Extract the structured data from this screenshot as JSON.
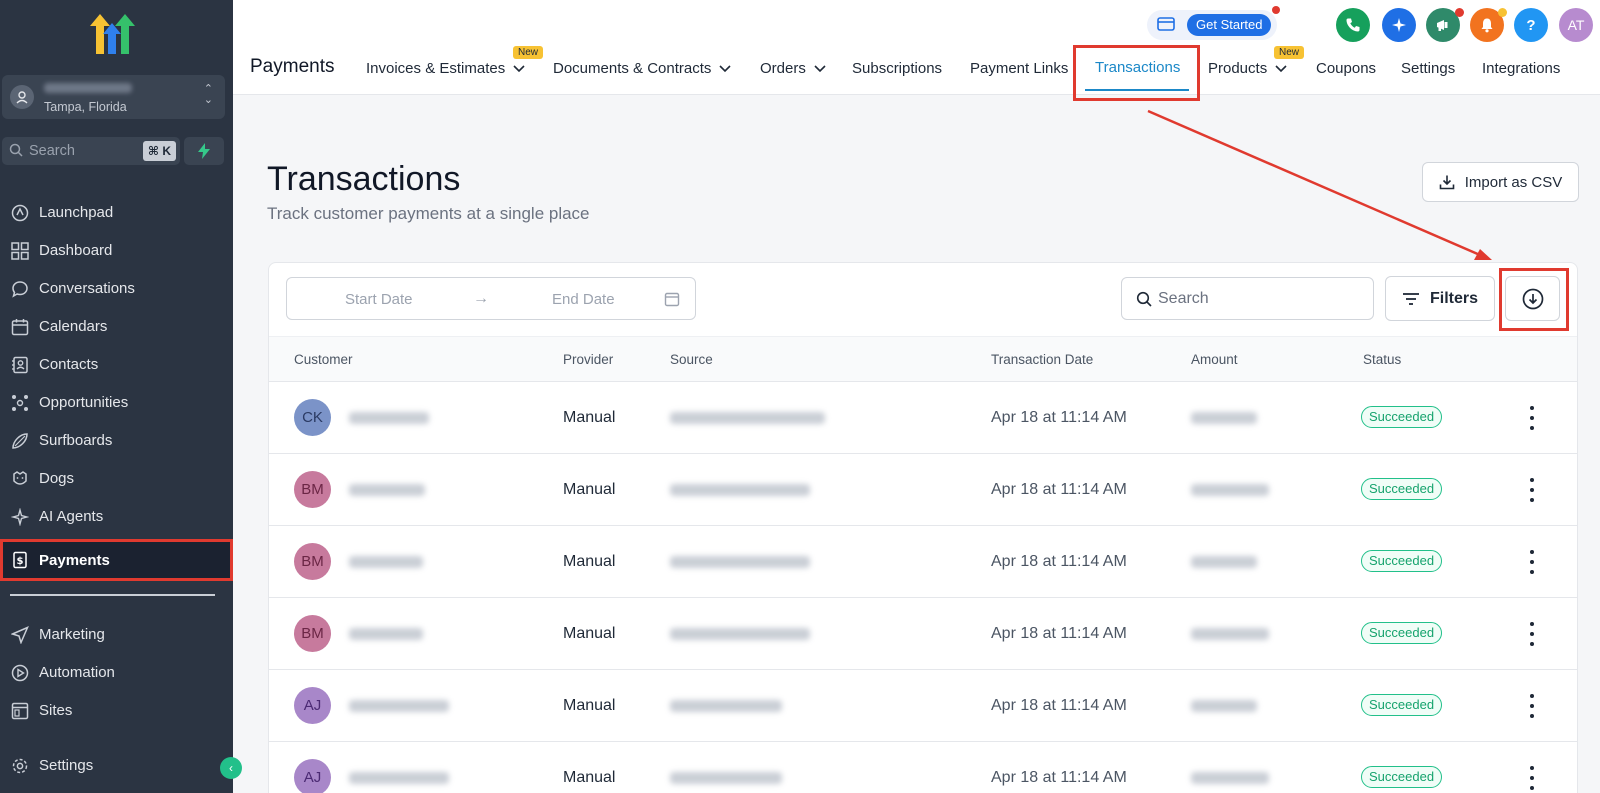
{
  "sidebar": {
    "location_city": "Tampa, Florida",
    "search_placeholder": "Search",
    "search_shortcut": "⌘ K",
    "items": [
      {
        "label": "Launchpad",
        "icon": "rocket-icon"
      },
      {
        "label": "Dashboard",
        "icon": "grid-icon"
      },
      {
        "label": "Conversations",
        "icon": "chat-icon"
      },
      {
        "label": "Calendars",
        "icon": "calendar-icon"
      },
      {
        "label": "Contacts",
        "icon": "contacts-icon"
      },
      {
        "label": "Opportunities",
        "icon": "opportunities-icon"
      },
      {
        "label": "Surfboards",
        "icon": "surfboard-icon"
      },
      {
        "label": "Dogs",
        "icon": "dog-icon"
      },
      {
        "label": "AI Agents",
        "icon": "sparkle-icon"
      },
      {
        "label": "Payments",
        "icon": "payments-icon",
        "active": true
      }
    ],
    "items_bottom": [
      {
        "label": "Marketing",
        "icon": "send-icon"
      },
      {
        "label": "Automation",
        "icon": "automation-icon"
      },
      {
        "label": "Sites",
        "icon": "sites-icon"
      }
    ],
    "settings_label": "Settings"
  },
  "header": {
    "app_title": "Payments",
    "tabs": [
      {
        "label": "Invoices & Estimates",
        "dropdown": true,
        "badge": "New"
      },
      {
        "label": "Documents & Contracts",
        "dropdown": true
      },
      {
        "label": "Orders",
        "dropdown": true
      },
      {
        "label": "Subscriptions"
      },
      {
        "label": "Payment Links"
      },
      {
        "label": "Transactions",
        "active": true
      },
      {
        "label": "Products",
        "dropdown": true,
        "badge": "New"
      },
      {
        "label": "Coupons"
      },
      {
        "label": "Settings"
      },
      {
        "label": "Integrations"
      }
    ],
    "get_started": "Get Started",
    "avatar_initials": "AT",
    "help_glyph": "?"
  },
  "main": {
    "title": "Transactions",
    "subtitle": "Track customer payments at a single place",
    "import_label": "Import as CSV",
    "start_date_placeholder": "Start Date",
    "end_date_placeholder": "End Date",
    "search_placeholder": "Search",
    "filters_label": "Filters",
    "columns": [
      "Customer",
      "Provider",
      "Source",
      "Transaction Date",
      "Amount",
      "Status"
    ],
    "rows": [
      {
        "initials": "CK",
        "provider": "Manual",
        "date": "Apr 18 at 11:14 AM",
        "status": "Succeeded"
      },
      {
        "initials": "BM",
        "provider": "Manual",
        "date": "Apr 18 at 11:14 AM",
        "status": "Succeeded"
      },
      {
        "initials": "BM",
        "provider": "Manual",
        "date": "Apr 18 at 11:14 AM",
        "status": "Succeeded"
      },
      {
        "initials": "BM",
        "provider": "Manual",
        "date": "Apr 18 at 11:14 AM",
        "status": "Succeeded"
      },
      {
        "initials": "AJ",
        "provider": "Manual",
        "date": "Apr 18 at 11:14 AM",
        "status": "Succeeded"
      },
      {
        "initials": "AJ",
        "provider": "Manual",
        "date": "Apr 18 at 11:14 AM",
        "status": "Succeeded"
      }
    ]
  },
  "colors": {
    "accent": "#1b88c8",
    "highlight": "#e03a2f",
    "sidebar_bg": "#2b3442",
    "success": "#22c08a",
    "avatar_ck": "#7b93c8",
    "avatar_bm": "#c77a9d",
    "avatar_aj": "#a887c9"
  }
}
